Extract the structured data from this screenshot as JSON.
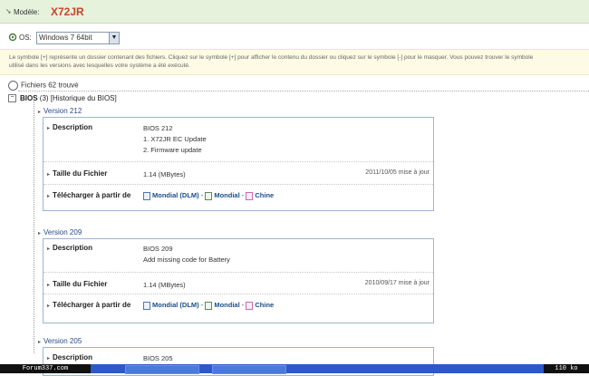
{
  "header": {
    "model_label": "Modèle:",
    "model_value": "X72JR"
  },
  "os": {
    "label": "OS:",
    "selected": "Windows 7 64bit"
  },
  "notice": {
    "line1": "Le symbole [+] représente un dossier contenant des fichiers. Cliquez sur le symbole [+] pour afficher le contenu du dossier ou cliquez sur le symbole [-] pour le masquer. Vous pouvez trouver le symbole",
    "line2": "utilisé dans les versions avec lesquelles votre système a été exécuté."
  },
  "files_found": "Fichiers 62 trouvé",
  "bios_header": {
    "title": "BIOS",
    "count": "(3)",
    "history": "[Historique du BIOS]"
  },
  "labels": {
    "description": "Description",
    "file_size": "Taille du Fichier",
    "download": "Télécharger à partir de"
  },
  "download_links": {
    "global_dlm": "Mondial (DLM)",
    "global": "Mondial",
    "china": "Chine",
    "sep": "-"
  },
  "versions": [
    {
      "title": "Version 212",
      "description": [
        "BIOS 212",
        "1. X72JR EC Update",
        "2. Firmware update"
      ],
      "size": "1.14 (MBytes)",
      "date": "2011/10/05 mise à jour"
    },
    {
      "title": "Version 209",
      "description": [
        "BIOS 209",
        "Add missing code for Battery"
      ],
      "size": "1.14 (MBytes)",
      "date": "2010/09/17 mise à jour"
    },
    {
      "title": "Version 205",
      "description": [
        "BIOS 205"
      ]
    }
  ],
  "taskbar": {
    "watermark": "Forum337.com",
    "size": "110 ko"
  },
  "colors": {
    "model": "#c8442a",
    "version_link": "#2a4a8a",
    "card_border": "#9ab6d2",
    "taskbar": "#2c58c8"
  }
}
